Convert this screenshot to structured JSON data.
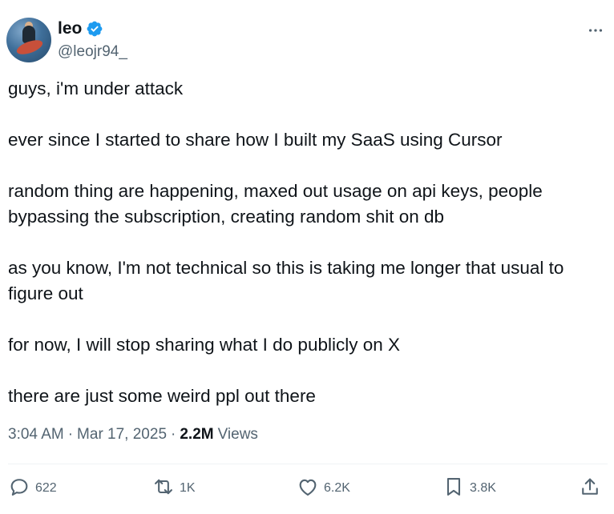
{
  "author": {
    "display_name": "leo",
    "handle": "@leojr94_"
  },
  "tweet": {
    "paragraphs": [
      "guys, i'm under attack",
      "ever since I started to share how I built my SaaS using Cursor",
      "random thing are happening, maxed out usage on api keys, people bypassing the subscription, creating random shit on db",
      "as you know, I'm not technical so this is taking me longer that usual to figure out",
      "for now, I will stop sharing what I do publicly on X",
      "there are just some weird ppl out there"
    ],
    "time": "3:04 AM",
    "date": "Mar 17, 2025",
    "separator": "·",
    "views_count": "2.2M",
    "views_label": "Views"
  },
  "actions": {
    "replies": "622",
    "reposts": "1K",
    "likes": "6.2K",
    "bookmarks": "3.8K"
  },
  "icons": {
    "verified": "verified-badge-icon",
    "more": "more-icon",
    "reply": "reply-icon",
    "repost": "repost-icon",
    "like": "heart-icon",
    "bookmark": "bookmark-icon",
    "share": "share-icon"
  },
  "colors": {
    "verified_blue": "#1d9bf0",
    "text_primary": "#0f1419",
    "text_secondary": "#536471"
  }
}
